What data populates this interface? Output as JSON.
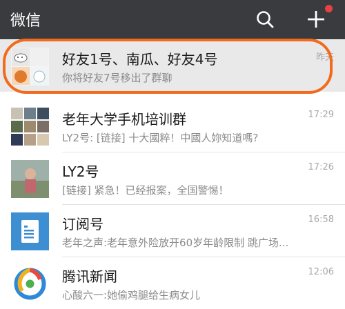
{
  "header": {
    "title": "微信",
    "search_icon": "search-icon",
    "plus_icon": "plus-icon",
    "accent": "#e64340"
  },
  "chats": [
    {
      "name": "好友1号、南瓜、好友4号",
      "message": "你将好友7号移出了群聊",
      "time": "昨天",
      "avatar": "group-avatar"
    },
    {
      "name": "老年大学手机培训群",
      "message": "LY2号: [链接] 十大國粹！中國人妳知道嗎?",
      "time": "17:29",
      "avatar": "group-avatar"
    },
    {
      "name": "LY2号",
      "message": "[链接] 紧急！已经报案，全国警惕！",
      "time": "17:26",
      "avatar": "user-avatar"
    },
    {
      "name": "订阅号",
      "message": "老年之声:老年意外险放开60岁年龄限制 跳广场...",
      "time": "16:58",
      "avatar": "subscription-icon"
    },
    {
      "name": "腾讯新闻",
      "message": "心酸六一:她偷鸡腿给生病女儿",
      "time": "12:06",
      "avatar": "tencent-news-icon"
    }
  ],
  "highlight_color": "#f26a1b"
}
